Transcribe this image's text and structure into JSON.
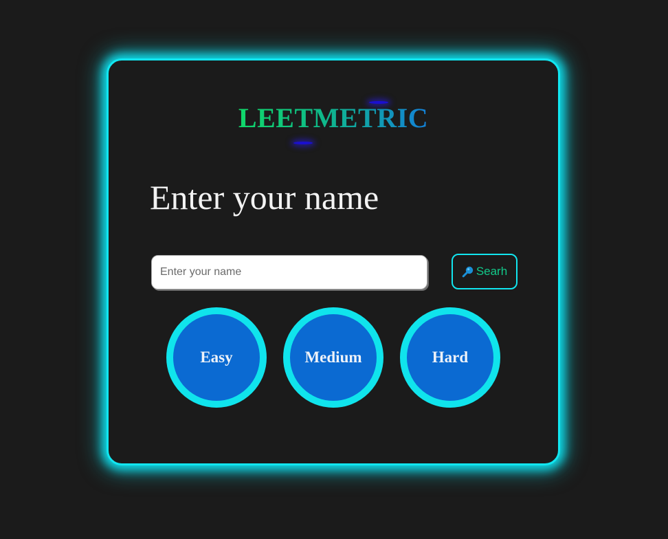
{
  "app": {
    "logo": "LEETMETRIC"
  },
  "form": {
    "heading": "Enter your name",
    "input_placeholder": "Enter your name",
    "input_value": "",
    "search_label": "Searh"
  },
  "stats": [
    {
      "label": "Easy"
    },
    {
      "label": "Medium"
    },
    {
      "label": "Hard"
    }
  ],
  "icons": {
    "search": "search-icon"
  },
  "colors": {
    "background": "#1b1b1b",
    "accent_cyan": "#11e6f0",
    "circle_fill": "#0b6ad2",
    "logo_gradient_start": "#10d86a",
    "logo_gradient_end": "#1380d8",
    "search_text": "#12c98a"
  }
}
